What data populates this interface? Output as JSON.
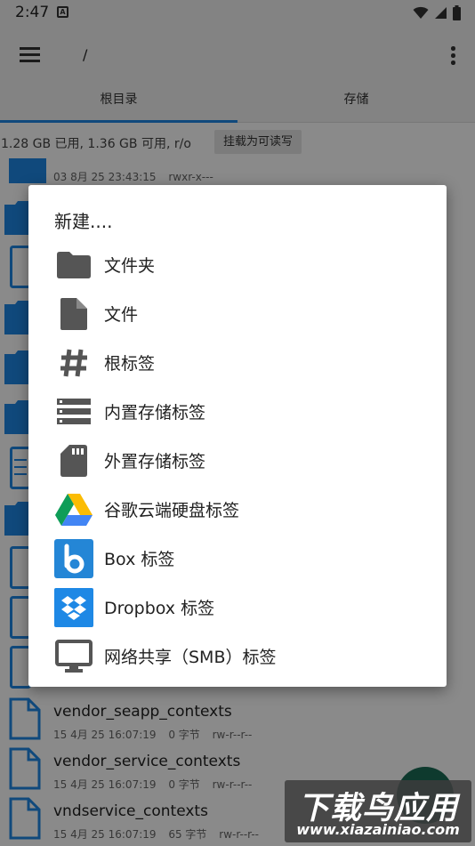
{
  "status_bar": {
    "time": "2:47",
    "notif_icon": "A"
  },
  "toolbar": {
    "path": "/"
  },
  "tabs": [
    {
      "label": "根目录",
      "active": true
    },
    {
      "label": "存储",
      "active": false
    }
  ],
  "storage": {
    "info": "1.28 GB 已用, 1.36 GB 可用, r/o",
    "readonly_button": "挂载为可读写"
  },
  "files": [
    {
      "name": "",
      "date": "03 8月 25 23:43:15",
      "size": "",
      "perms": "rwxr-x---",
      "type": "folder"
    },
    {
      "name": "vendor_seapp_contexts",
      "date": "15 4月 25 16:07:19",
      "size": "0 字节",
      "perms": "rw-r--r--",
      "type": "file"
    },
    {
      "name": "vendor_service_contexts",
      "date": "15 4月 25 16:07:19",
      "size": "0 字节",
      "perms": "rw-r--r--",
      "type": "file"
    },
    {
      "name": "vndservice_contexts",
      "date": "15 4月 25 16:07:19",
      "size": "65 字节",
      "perms": "rw-r--r--",
      "type": "file"
    }
  ],
  "dialog": {
    "title": "新建....",
    "options": [
      {
        "label": "文件夹",
        "icon": "folder-icon"
      },
      {
        "label": "文件",
        "icon": "file-icon"
      },
      {
        "label": "根标签",
        "icon": "hash-icon"
      },
      {
        "label": "内置存储标签",
        "icon": "storage-icon"
      },
      {
        "label": "外置存储标签",
        "icon": "sd-card-icon"
      },
      {
        "label": "谷歌云端硬盘标签",
        "icon": "google-drive-icon"
      },
      {
        "label": "Box 标签",
        "icon": "box-icon"
      },
      {
        "label": "Dropbox 标签",
        "icon": "dropbox-icon"
      },
      {
        "label": "网络共享（SMB）标签",
        "icon": "monitor-icon"
      }
    ]
  },
  "watermark": {
    "big": "下载鸟应用",
    "small": "www.xiazainiao.com"
  },
  "colors": {
    "accent": "#1e88e5",
    "fab": "#1b6b55",
    "folder_blue": "#1e88e5"
  }
}
